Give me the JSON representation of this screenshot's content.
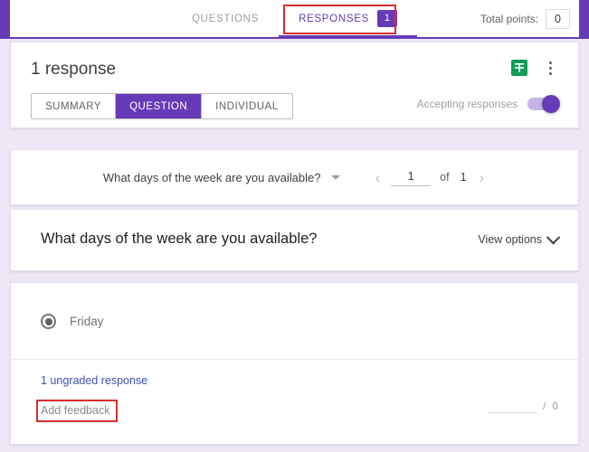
{
  "topbar": {
    "tabs": [
      {
        "label": "QUESTIONS",
        "active": false,
        "badge": ""
      },
      {
        "label": "RESPONSES",
        "active": true,
        "badge": "1"
      }
    ],
    "total_points_label": "Total points:",
    "total_points_value": "0",
    "accent_color": "#673ab7",
    "annotation_color": "#d32f2f"
  },
  "summary": {
    "response_count": "1 response",
    "segments": [
      {
        "label": "SUMMARY",
        "active": false
      },
      {
        "label": "QUESTION",
        "active": true
      },
      {
        "label": "INDIVIDUAL",
        "active": false
      }
    ],
    "sheets_icon": "google-sheets-icon",
    "more_icon": "kebab-menu-icon",
    "accepting_label": "Accepting responses",
    "accepting_state": "on"
  },
  "navigator": {
    "question_selector": "What days of the week are you available?",
    "dropdown_icon": "caret-down-icon",
    "prev_icon": "chevron-left-icon",
    "next_icon": "chevron-right-icon",
    "current_page": "1",
    "of_label": "of",
    "total_pages": "1"
  },
  "question": {
    "title": "What days of the week are you available?",
    "view_options_label": "View options",
    "view_options_icon": "chevron-down-icon"
  },
  "answers": {
    "options": [
      {
        "label": "Friday",
        "selected": true
      }
    ],
    "ungraded_label": "1 ungraded response",
    "add_feedback_label": "Add feedback",
    "score_value": "",
    "score_separator": "/",
    "score_total": "0"
  }
}
